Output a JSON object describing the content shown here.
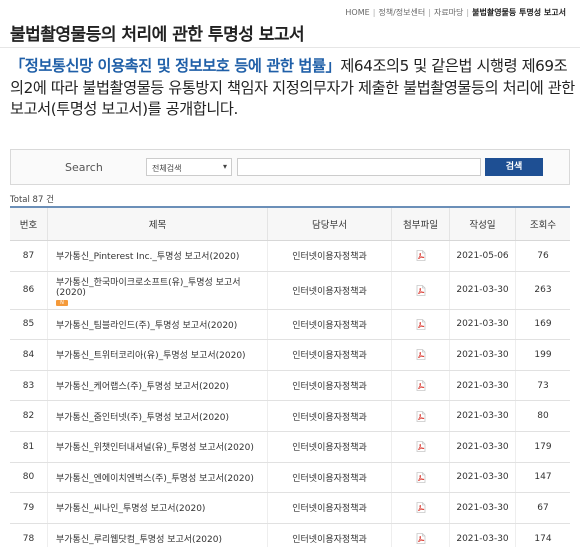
{
  "page": {
    "title": "불법촬영물등의 처리에 관한 투명성 보고서",
    "breadcrumb": [
      "HOME",
      "정책/정보센터",
      "자료마당",
      "불법촬영물등 투명성 보고서"
    ],
    "intro": {
      "law": "「정보통신망 이용촉진 및 정보보호 등에 관한 법률」",
      "text": "제64조의5 및 같은법 시행령 제69조의2에 따라 불법촬영물등 유통방지 책임자 지정의무자가 제출한 불법촬영물등의 처리에 관한 보고서(투명성 보고서)를 공개합니다."
    }
  },
  "search": {
    "label": "Search",
    "select_value": "전체검색",
    "input_value": "",
    "button_label": "검색"
  },
  "total": "Total 87 건",
  "table": {
    "headers": [
      "번호",
      "제목",
      "담당부서",
      "첨부파일",
      "작성일",
      "조회수"
    ],
    "rows": [
      {
        "no": "87",
        "title": "부가통신_Pinterest Inc._투명성 보고서(2020)",
        "dept": "인터넷이용자정책과",
        "date": "2021-05-06",
        "views": "76",
        "new": false
      },
      {
        "no": "86",
        "title": "부가통신_한국마이크로소프트(유)_투명성 보고서(2020)",
        "dept": "인터넷이용자정책과",
        "date": "2021-03-30",
        "views": "263",
        "new": true
      },
      {
        "no": "85",
        "title": "부가통신_팀블라인드(주)_투명성 보고서(2020)",
        "dept": "인터넷이용자정책과",
        "date": "2021-03-30",
        "views": "169",
        "new": false
      },
      {
        "no": "84",
        "title": "부가통신_트위터코리아(유)_투명성 보고서(2020)",
        "dept": "인터넷이용자정책과",
        "date": "2021-03-30",
        "views": "199",
        "new": false
      },
      {
        "no": "83",
        "title": "부가통신_케어랩스(주)_투명성 보고서(2020)",
        "dept": "인터넷이용자정책과",
        "date": "2021-03-30",
        "views": "73",
        "new": false
      },
      {
        "no": "82",
        "title": "부가통신_줌인터넷(주)_투명성 보고서(2020)",
        "dept": "인터넷이용자정책과",
        "date": "2021-03-30",
        "views": "80",
        "new": false
      },
      {
        "no": "81",
        "title": "부가통신_위챗인터내셔널(유)_투명성 보고서(2020)",
        "dept": "인터넷이용자정책과",
        "date": "2021-03-30",
        "views": "179",
        "new": false
      },
      {
        "no": "80",
        "title": "부가통신_엔에이치엔벅스(주)_투명성 보고서(2020)",
        "dept": "인터넷이용자정책과",
        "date": "2021-03-30",
        "views": "147",
        "new": false
      },
      {
        "no": "79",
        "title": "부가통신_씨나인_투명성 보고서(2020)",
        "dept": "인터넷이용자정책과",
        "date": "2021-03-30",
        "views": "67",
        "new": false
      },
      {
        "no": "78",
        "title": "부가통신_루리웹닷컴_투명성 보고서(2020)",
        "dept": "인터넷이용자정책과",
        "date": "2021-03-30",
        "views": "174",
        "new": false
      }
    ]
  },
  "icons": {
    "attachment": "pdf-icon",
    "new_badge": "new-icon",
    "select_arrow": "chevron-down-icon"
  },
  "colors": {
    "accent": "#1e4f93",
    "law_link": "#1f5fa8",
    "pdf": "#d9342b",
    "badge": "#f59a3a"
  }
}
